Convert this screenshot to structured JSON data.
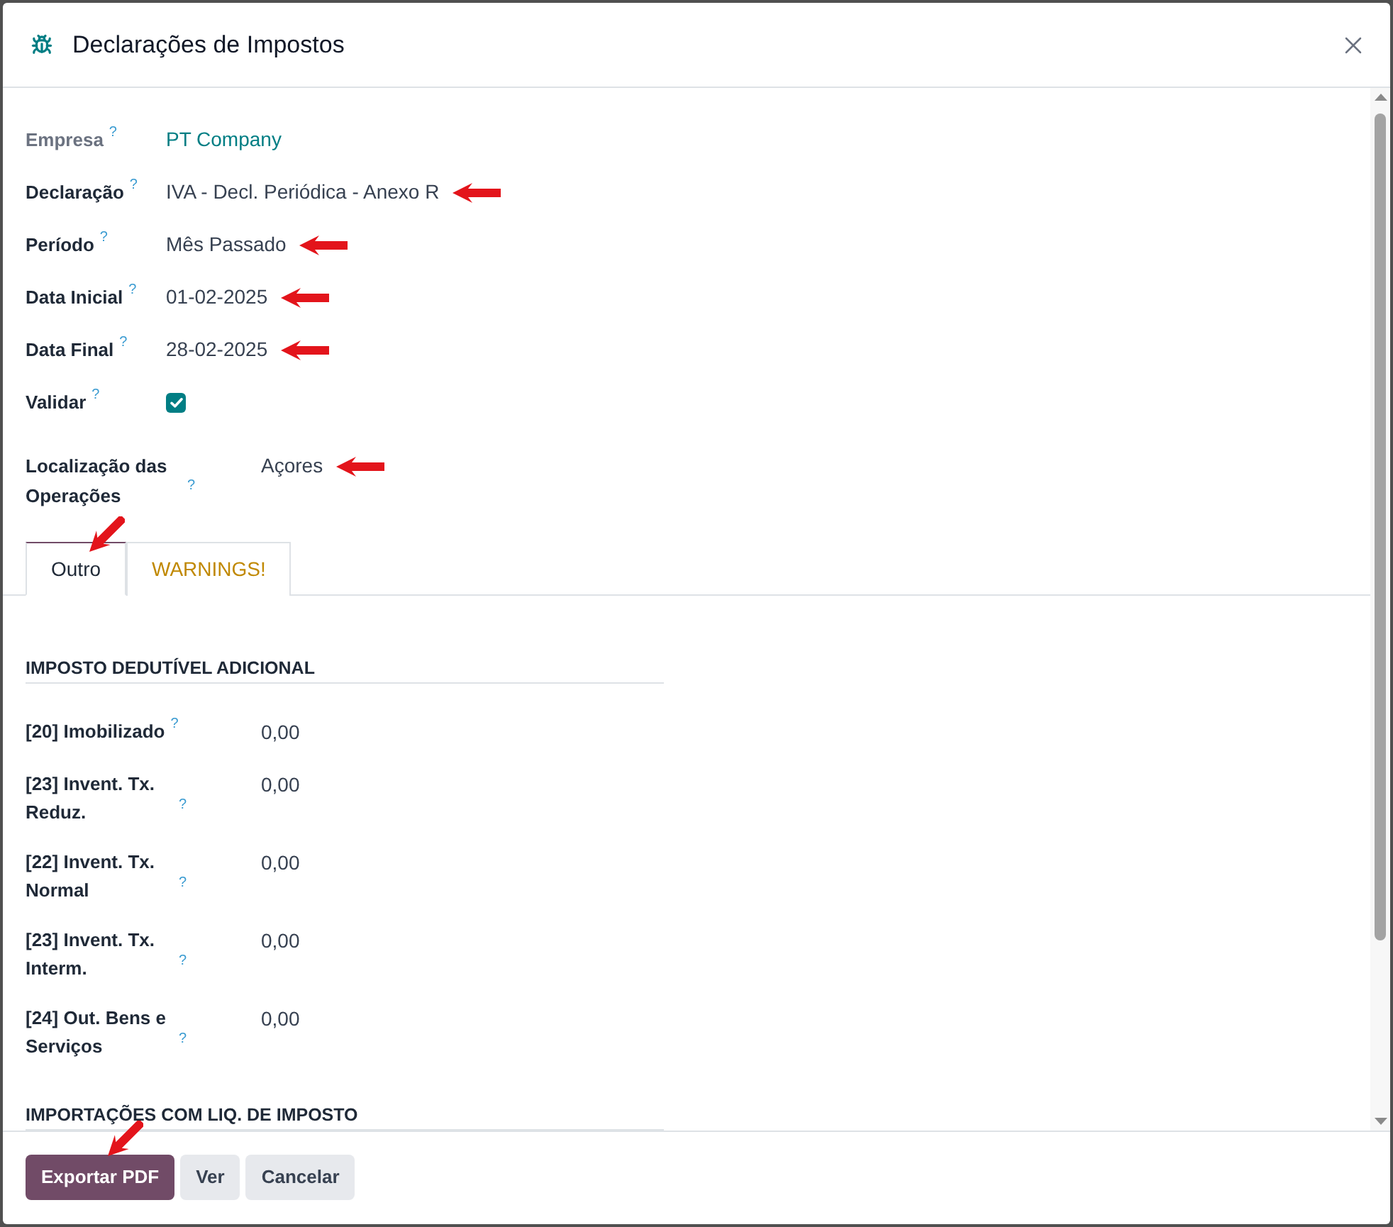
{
  "dialog": {
    "title": "Declarações de Impostos"
  },
  "fields": [
    {
      "label": "Empresa",
      "tooltip": "?",
      "kind": "link",
      "value": "PT Company",
      "readonly": true,
      "marked_with_arrow": false
    },
    {
      "label": "Declaração",
      "tooltip": "?",
      "kind": "text",
      "value": "IVA - Decl. Periódica - Anexo R",
      "readonly": false,
      "marked_with_arrow": true
    },
    {
      "label": "Período",
      "tooltip": "?",
      "kind": "text",
      "value": "Mês Passado",
      "readonly": false,
      "marked_with_arrow": true
    },
    {
      "label": "Data Inicial",
      "tooltip": "?",
      "kind": "text",
      "value": "01-02-2025",
      "readonly": false,
      "marked_with_arrow": true
    },
    {
      "label": "Data Final",
      "tooltip": "?",
      "kind": "text",
      "value": "28-02-2025",
      "readonly": false,
      "marked_with_arrow": true
    },
    {
      "label": "Validar",
      "tooltip": "?",
      "kind": "checkbox",
      "checked": true,
      "readonly": false,
      "marked_with_arrow": false
    }
  ],
  "operations_location": {
    "label": "Localização das Operações",
    "tooltip": "?",
    "value": "Açores",
    "marked_with_arrow": true
  },
  "tabs": [
    {
      "label": "Outro",
      "kind": "normal",
      "selected": true,
      "marked_with_arrow": true
    },
    {
      "label": "WARNINGS!",
      "kind": "warning",
      "selected": false,
      "marked_with_arrow": false
    }
  ],
  "sections": [
    {
      "heading": "IMPOSTO DEDUTÍVEL ADICIONAL",
      "rows": [
        {
          "label": "[20] Imobilizado",
          "tooltip": "?",
          "value": "0,00"
        },
        {
          "label": "[23] Invent. Tx. Reduz.",
          "tooltip": "?",
          "value": "0,00"
        },
        {
          "label": "[22] Invent. Tx. Normal",
          "tooltip": "?",
          "value": "0,00"
        },
        {
          "label": "[23] Invent. Tx. Interm.",
          "tooltip": "?",
          "value": "0,00"
        },
        {
          "label": "[24] Out. Bens e Serviços",
          "tooltip": "?",
          "value": "0,00"
        }
      ]
    },
    {
      "heading": "IMPORTAÇÕES COM LIQ. DE IMPOSTO"
    }
  ],
  "footer_buttons": [
    {
      "label": "Exportar PDF",
      "kind": "primary",
      "marked_with_arrow": true
    },
    {
      "label": "Ver",
      "kind": "secondary",
      "marked_with_arrow": false
    },
    {
      "label": "Cancelar",
      "kind": "secondary",
      "marked_with_arrow": false
    }
  ]
}
